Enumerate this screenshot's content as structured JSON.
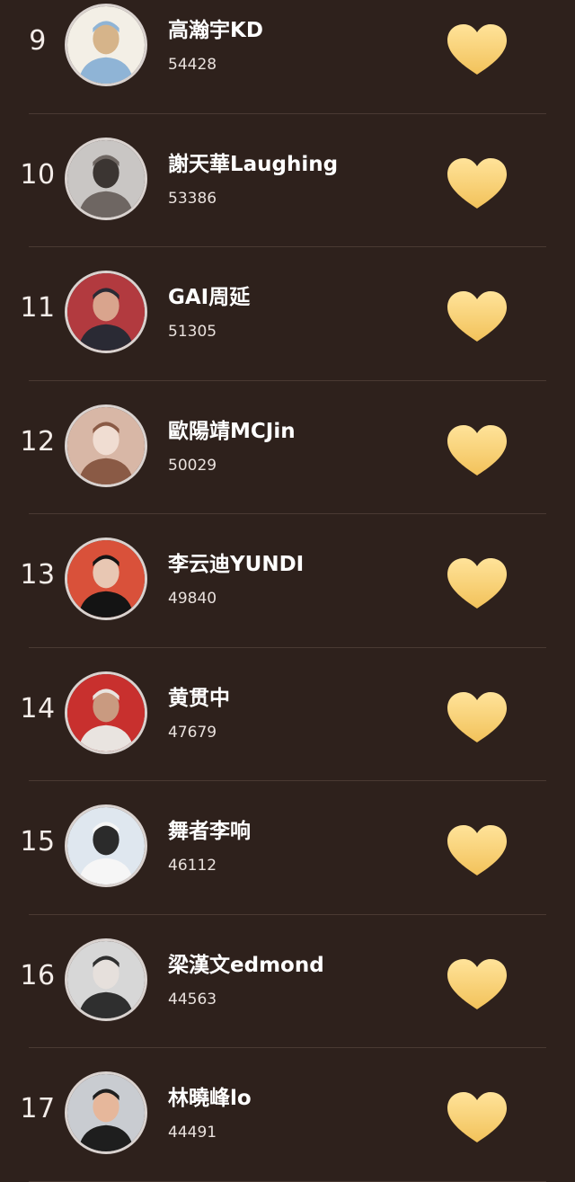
{
  "rankings": [
    {
      "rank": "9",
      "name": "高瀚宇KD",
      "score": "54428",
      "avatar": "cartoon-couple-avatar",
      "avatar_colors": [
        "#f3efe6",
        "#8fb4d6",
        "#d6b48a"
      ]
    },
    {
      "rank": "10",
      "name": "謝天華Laughing",
      "score": "53386",
      "avatar": "shirtless-man-grey-avatar",
      "avatar_colors": [
        "#c9c6c4",
        "#6e6662",
        "#3b3532"
      ]
    },
    {
      "rank": "11",
      "name": "GAI周延",
      "score": "51305",
      "avatar": "man-red-background-avatar",
      "avatar_colors": [
        "#b23a3f",
        "#2a2a34",
        "#d9a48d"
      ]
    },
    {
      "rank": "12",
      "name": "歐陽靖MCJin",
      "score": "50029",
      "avatar": "child-photo-avatar",
      "avatar_colors": [
        "#d8b7a6",
        "#8a5a45",
        "#f0ddd2"
      ]
    },
    {
      "rank": "13",
      "name": "李云迪YUNDI",
      "score": "49840",
      "avatar": "man-suit-red-background-avatar",
      "avatar_colors": [
        "#d9513a",
        "#141414",
        "#e8c7b3"
      ]
    },
    {
      "rank": "14",
      "name": "黄贯中",
      "score": "47679",
      "avatar": "shirtless-man-red-avatar",
      "avatar_colors": [
        "#c8302e",
        "#e9e4e0",
        "#c99a80"
      ]
    },
    {
      "rank": "15",
      "name": "舞者李响",
      "score": "46112",
      "avatar": "man-white-jacket-avatar",
      "avatar_colors": [
        "#dfe7ef",
        "#f6f6f6",
        "#2b2b2b"
      ]
    },
    {
      "rank": "16",
      "name": "梁漢文edmond",
      "score": "44563",
      "avatar": "man-grey-portrait-avatar",
      "avatar_colors": [
        "#d7d7d7",
        "#2f2f2f",
        "#e6e0dc"
      ]
    },
    {
      "rank": "17",
      "name": "林曉峰lo",
      "score": "44491",
      "avatar": "man-glasses-avatar",
      "avatar_colors": [
        "#c9ccd1",
        "#1e1e1e",
        "#e6b79b"
      ]
    }
  ],
  "like_icon": "heart-icon",
  "colors": {
    "background": "#2e211c",
    "heart_top": "#ffe39a",
    "heart_bottom": "#f2c25a",
    "divider": "#4a3a33"
  }
}
